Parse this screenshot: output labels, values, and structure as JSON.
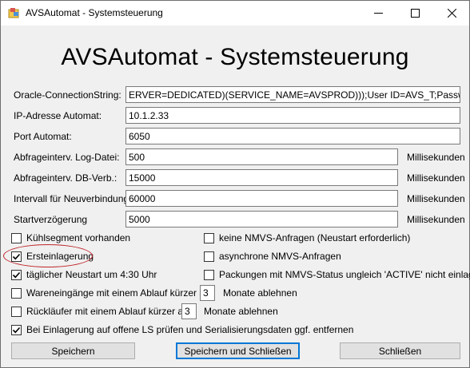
{
  "window": {
    "title": "AVSAutomat - Systemsteuerung",
    "icon": "app-icon",
    "controls": [
      "minimize-icon",
      "maximize-icon",
      "close-icon"
    ]
  },
  "heading": "AVSAutomat - Systemsteuerung",
  "fields": [
    {
      "label": "Oracle-ConnectionString:",
      "value": "ERVER=DEDICATED)(SERVICE_NAME=AVSPROD)));User ID=AVS_T;Password=AVS",
      "unit": ""
    },
    {
      "label": "IP-Adresse Automat:",
      "value": "10.1.2.33",
      "unit": ""
    },
    {
      "label": "Port Automat:",
      "value": "6050",
      "unit": ""
    },
    {
      "label": "Abfrageinterv. Log-Datei:",
      "value": "500",
      "unit": "Millisekunden"
    },
    {
      "label": "Abfrageinterv. DB-Verb.:",
      "value": "15000",
      "unit": "Millisekunden"
    },
    {
      "label": "Intervall für Neuverbindung:",
      "value": "60000",
      "unit": "Millisekunden"
    },
    {
      "label": "Startverzögerung",
      "value": "5000",
      "unit": "Millisekunden"
    }
  ],
  "checkboxes": {
    "kuehlsegment": {
      "label": "Kühlsegment vorhanden",
      "checked": false
    },
    "keine_nmvs": {
      "label": "keine NMVS-Anfragen (Neustart erforderlich)",
      "checked": false
    },
    "ersteinlagerung": {
      "label": "Ersteinlagerung",
      "checked": true
    },
    "async_nmvs": {
      "label": "asynchrone NMVS-Anfragen",
      "checked": false
    },
    "neustart": {
      "label": "täglicher Neustart um 4:30 Uhr",
      "checked": true
    },
    "packungen_status": {
      "label": "Packungen mit NMVS-Status ungleich 'ACTIVE' nicht einlagern",
      "checked": false
    },
    "wareneingaenge": {
      "label": "Wareneingänge mit einem Ablauf kürzer als",
      "checked": false,
      "months": "3",
      "suffix": "Monate ablehnen"
    },
    "ruecklaeufer": {
      "label": "Rückläufer mit einem Ablauf kürzer als",
      "checked": false,
      "months": "3",
      "suffix": "Monate ablehnen"
    },
    "einlagerung_ls": {
      "label": "Bei Einlagerung auf offene LS prüfen und Serialisierungsdaten ggf. entfernen",
      "checked": true
    }
  },
  "buttons": {
    "save": "Speichern",
    "save_close": "Speichern und Schließen",
    "close": "Schließen"
  }
}
